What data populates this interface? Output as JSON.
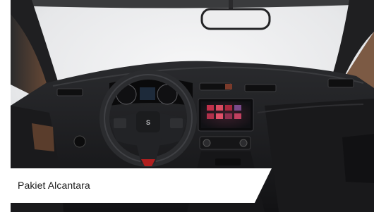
{
  "caption": {
    "text": "Pakiet Alcantara"
  },
  "photo": {
    "subject": "car-interior-dashboard-photo",
    "brand_mark": "seat-logo"
  },
  "colors": {
    "caption_bg": "#ffffff",
    "caption_text": "#1a1a1a",
    "windshield": "#e9eaec",
    "dash": "#1b1c1e"
  }
}
